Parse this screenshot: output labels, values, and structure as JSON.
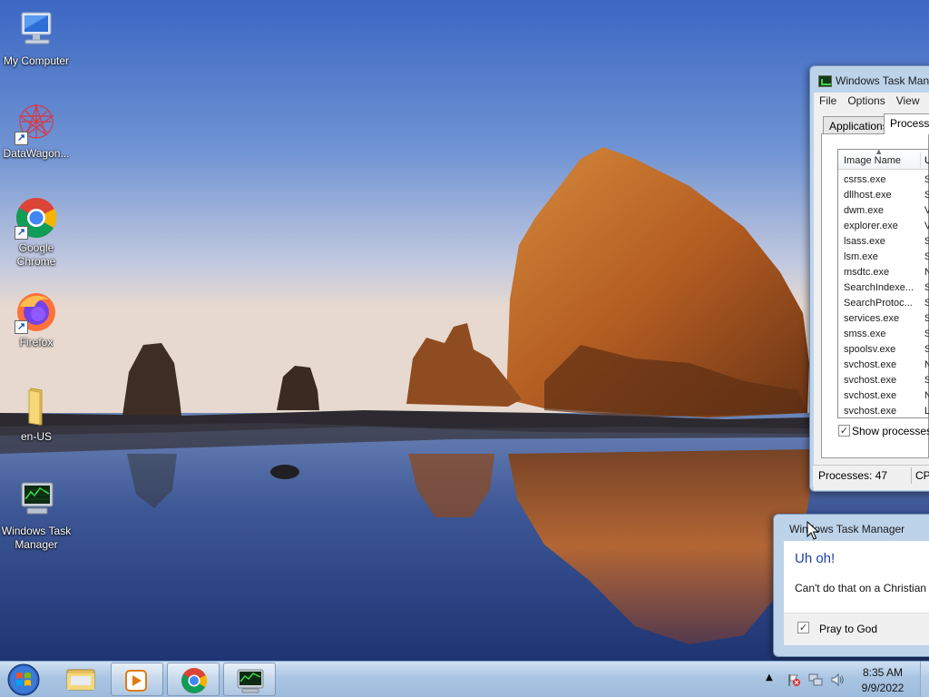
{
  "desktop": {
    "icons": [
      {
        "label": "My Computer",
        "icon": "computer-icon"
      },
      {
        "label": "DataWagon...",
        "icon": "datawagon-icon"
      },
      {
        "label": "Google Chrome",
        "icon": "chrome-icon"
      },
      {
        "label": "Firefox",
        "icon": "firefox-icon"
      },
      {
        "label": "en-US",
        "icon": "folder-icon"
      },
      {
        "label": "Windows Task Manager",
        "icon": "task-manager-icon"
      }
    ]
  },
  "task_manager": {
    "title": "Windows Task Man",
    "menu": [
      "File",
      "Options",
      "View"
    ],
    "tabs": [
      "Applications",
      "Processe"
    ],
    "columns": [
      "Image Name",
      "U"
    ],
    "processes": [
      {
        "name": "csrss.exe",
        "user": "S"
      },
      {
        "name": "dllhost.exe",
        "user": "S"
      },
      {
        "name": "dwm.exe",
        "user": "V"
      },
      {
        "name": "explorer.exe",
        "user": "V"
      },
      {
        "name": "lsass.exe",
        "user": "S"
      },
      {
        "name": "lsm.exe",
        "user": "S"
      },
      {
        "name": "msdtc.exe",
        "user": "N"
      },
      {
        "name": "SearchIndexe...",
        "user": "S"
      },
      {
        "name": "SearchProtoc...",
        "user": "S"
      },
      {
        "name": "services.exe",
        "user": "S"
      },
      {
        "name": "smss.exe",
        "user": "S"
      },
      {
        "name": "spoolsv.exe",
        "user": "S"
      },
      {
        "name": "svchost.exe",
        "user": "N"
      },
      {
        "name": "svchost.exe",
        "user": "S"
      },
      {
        "name": "svchost.exe",
        "user": "N"
      },
      {
        "name": "svchost.exe",
        "user": "L"
      }
    ],
    "show_processes_label": "Show processes f",
    "show_processes_checked": true,
    "status_processes": "Processes: 47",
    "status_cpu": "CP"
  },
  "dialog": {
    "title": "Windows Task Manager",
    "heading": "Uh oh!",
    "message": "Can't do that on a Christian",
    "checkbox_label": "Pray to God",
    "checkbox_checked": true
  },
  "taskbar": {
    "time": "8:35 AM",
    "date": "9/9/2022",
    "pinned": [
      "explorer-icon",
      "media-player-icon",
      "chrome-icon",
      "task-manager-icon"
    ]
  }
}
